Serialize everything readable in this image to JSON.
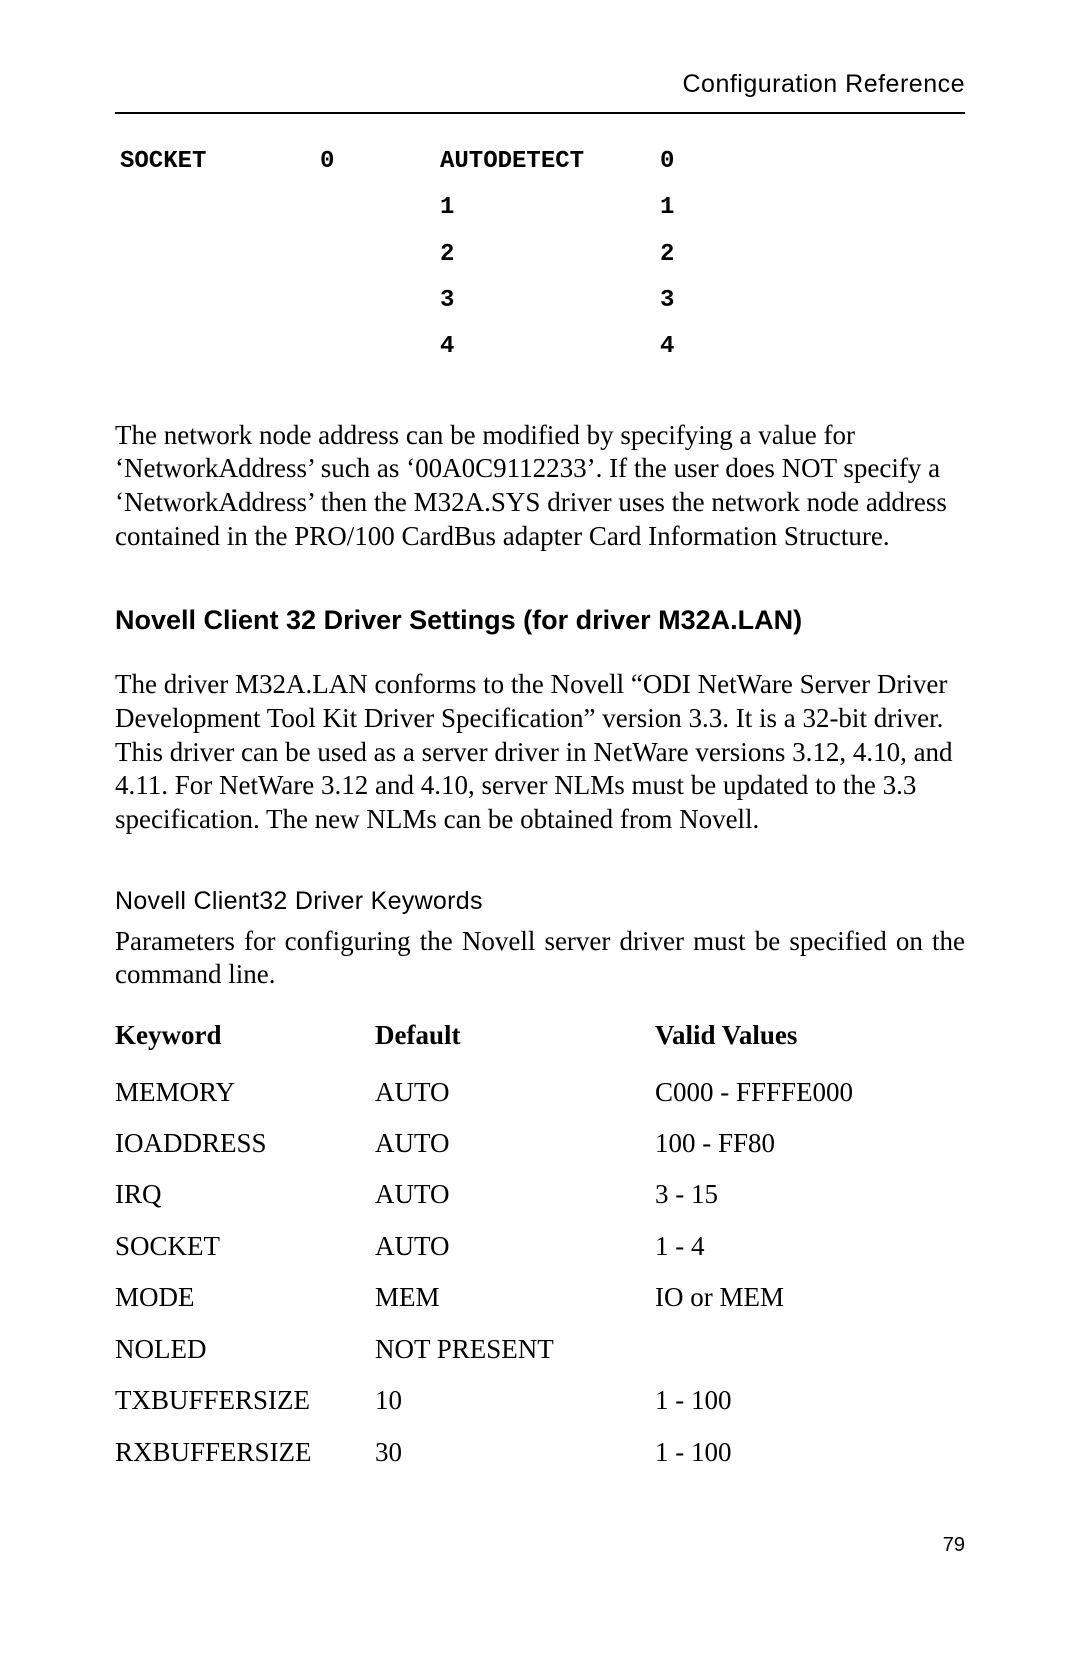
{
  "header": "Configuration Reference",
  "socketTable": {
    "label": "SOCKET",
    "col1Header": "AUTODETECT",
    "rows": [
      {
        "left": "0",
        "center": "AUTODETECT",
        "right": "0"
      },
      {
        "left": "",
        "center": "1",
        "right": "1"
      },
      {
        "left": "",
        "center": "2",
        "right": "2"
      },
      {
        "left": "",
        "center": "3",
        "right": "3"
      },
      {
        "left": "",
        "center": "4",
        "right": "4"
      }
    ]
  },
  "para1": "The network node address can be modified by specifying a value for ‘NetworkAddress’ such as ‘00A0C9112233’. If the user does NOT specify a ‘NetworkAddress’ then the M32A.SYS driver uses the network node address contained in the PRO/100 CardBus adapter Card Information Structure.",
  "heading1": "Novell Client 32 Driver Settings (for driver M32A.LAN)",
  "para2": "The driver M32A.LAN conforms to the Novell “ODI NetWare Server Driver Development Tool Kit Driver Specification” version 3.3. It is a 32-bit driver. This driver can be used as a server driver in NetWare versions 3.12, 4.10, and 4.11. For NetWare 3.12 and 4.10, server NLMs must be updated to the 3.3 specification. The new NLMs can be obtained from Novell.",
  "subHeading": "Novell Client32 Driver Keywords",
  "para3": "Parameters for configuring the Novell server driver must be specified on the command line.",
  "kwTable": {
    "headers": {
      "c1": "Keyword",
      "c2": "Default",
      "c3": "Valid Values"
    },
    "rows": [
      {
        "c1": "MEMORY",
        "c2": "AUTO",
        "c3": "C000 - FFFFE000"
      },
      {
        "c1": "IOADDRESS",
        "c2": "AUTO",
        "c3": "100 - FF80"
      },
      {
        "c1": "IRQ",
        "c2": "AUTO",
        "c3": "3 - 15"
      },
      {
        "c1": "SOCKET",
        "c2": "AUTO",
        "c3": "1 - 4"
      },
      {
        "c1": "MODE",
        "c2": "MEM",
        "c3": "IO or MEM"
      },
      {
        "c1": "NOLED",
        "c2": "NOT PRESENT",
        "c3": ""
      },
      {
        "c1": "TXBUFFERSIZE",
        "c2": "10",
        "c3": "1 - 100"
      },
      {
        "c1": "RXBUFFERSIZE",
        "c2": "30",
        "c3": "1 - 100"
      }
    ]
  },
  "pageNumber": "79"
}
